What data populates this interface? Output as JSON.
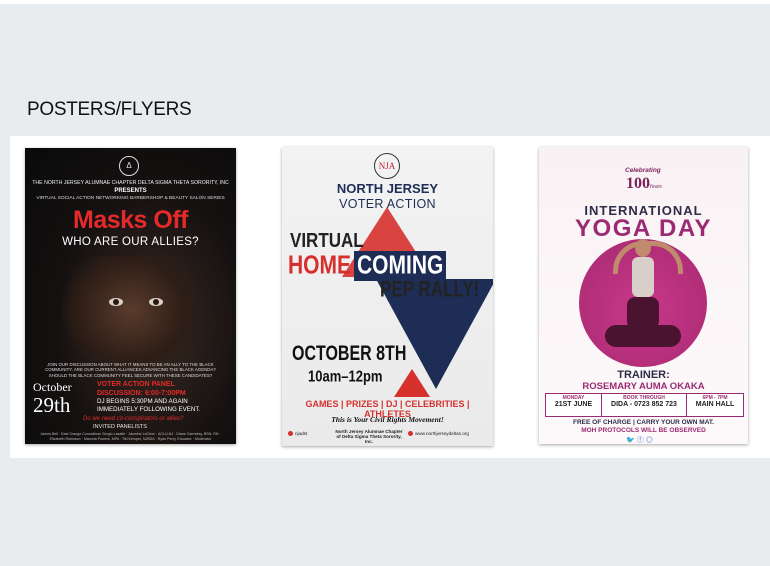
{
  "section": {
    "title": "POSTERS/FLYERS"
  },
  "posters": [
    {
      "logo": "Δ",
      "org": "THE NORTH JERSEY ALUMNAE CHAPTER DELTA SIGMA THETA SORORITY, INC",
      "presents": "PRESENTS",
      "series": "VIRTUAL SOCIAL ACTION NETWORKING BARBERSHOP & BEAUTY SALON SERIES",
      "headline": "Masks Off",
      "subheadline": "WHO ARE OUR ALLIES?",
      "description": "JOIN OUR DISCUSSION ABOUT WHAT IT MEANS TO BE AN ALLY TO THE BLACK COMMUNITY. ARE OUR CURRENT ALLIANCES ADVANCING THE BLACK AGENDA? SHOULD THE BLACK COMMUNITY FEEL SECURE WITH THESE CANDIDATES?",
      "date_month": "October",
      "date_day": "29th",
      "panel_line1": "VOTER ACTION PANEL",
      "panel_line2": "DISCUSSION: 6:00-7:00PM",
      "dj_line1": "DJ BEGINS 5:30PM AND AGAIN",
      "dj_line2": "IMMEDIATELY FOLLOWING EVENT.",
      "question": "Do we need co-conspirators or allies?",
      "invited": "INVITED PANELISTS",
      "names": "James Bell · East Orange Councilman Sergio Lasalle · Jasmine LeClerc · ACLU-NJ · Diane Carmelay, BSN, RN · Elizabeth Robinson · Marcela Powers, MPA · Tiki Kemper, NJBDA · Ryan Perry, Educator · Moderator"
    },
    {
      "logo": "NJA",
      "title_line1": "NORTH JERSEY",
      "title_line2": "VOTER ACTION",
      "virtual": "VIRTUAL",
      "home": "HOME",
      "coming": "COMING",
      "pep": "PEP RALLY!",
      "date": "OCTOBER 8TH",
      "time": "10am–12pm",
      "list": "GAMES | PRIZES | DJ | CELEBRITIES | ATHLETES",
      "slogan": "This is Your Civil Rights Movement!",
      "handle": "njadst",
      "chapter": "North Jersey Alumnae Chapter of Delta Sigma Theta Sorority, Inc.",
      "website": "www.northjerseydeltas.org"
    },
    {
      "celebrating": "Celebrating",
      "hundred": "100",
      "years": "Years",
      "title_line1": "INTERNATIONAL",
      "title_line2": "YOGA DAY",
      "trainer_label": "TRAINER:",
      "trainer_name": "ROSEMARY AUMA OKAKA",
      "info": [
        {
          "head": "MONDAY",
          "value": "21ST JUNE"
        },
        {
          "head": "BOOK THROUGH",
          "value": "DIDA - 0723 852 723"
        },
        {
          "head": "6PM - 7PM",
          "value": "MAIN HALL"
        }
      ],
      "free_note": "FREE OF CHARGE | CARRY YOUR OWN MAT.",
      "moh_note": "MOH PROTOCOLS WILL BE OBSERVED",
      "social": "🐦ⓕ◎"
    }
  ]
}
